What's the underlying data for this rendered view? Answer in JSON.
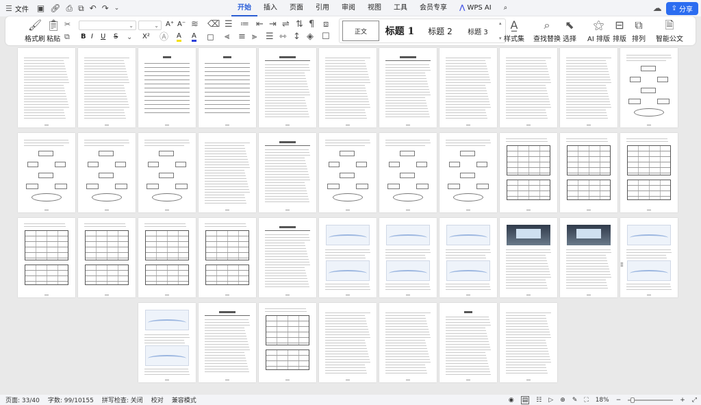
{
  "menubar": {
    "menu_label": "文件",
    "tabs": [
      "开始",
      "插入",
      "页面",
      "引用",
      "审阅",
      "视图",
      "工具",
      "会员专享"
    ],
    "active_tab": "开始",
    "wps_ai": "WPS AI",
    "share": "分享",
    "icons": {
      "hamburger": "menu-icon",
      "save": "save-icon",
      "link": "link-icon",
      "print": "print-icon",
      "print_preview": "print-preview-icon",
      "undo": "undo-icon",
      "redo": "redo-icon",
      "more": "chevron-down-icon",
      "search": "search-icon",
      "cloud": "cloud-sync-icon"
    }
  },
  "ribbon": {
    "format_painter": "格式刷",
    "paste": "粘贴",
    "styles": {
      "normal": "正文",
      "h1": "标题 1",
      "h2": "标题 2",
      "h3": "标题 3"
    },
    "style_set": "样式集",
    "find_replace": "查找替换",
    "select": "选择",
    "ai_layout": "AI 排版",
    "layout": "排版",
    "arrange": "排列",
    "smart_doc": "智能公文",
    "buttons": {
      "bold": "B",
      "italic": "I",
      "underline": "U",
      "strike": "S",
      "superscript": "X²",
      "font_grow": "A⁺",
      "font_shrink": "A⁻",
      "highlight_glyph": "A"
    }
  },
  "status": {
    "page": "页面: 33/40",
    "words": "字数: 99/10155",
    "spell": "拼写检查: 关闭",
    "proof": "校对",
    "compat": "兼容模式",
    "zoom": "18%"
  }
}
